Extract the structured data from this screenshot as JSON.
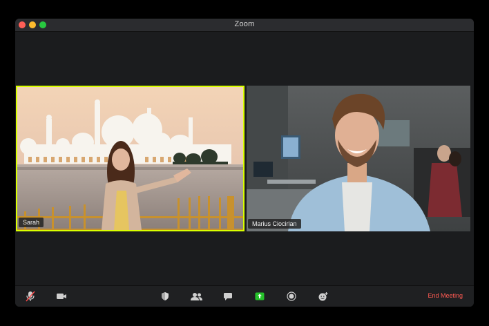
{
  "window": {
    "title": "Zoom"
  },
  "participants": [
    {
      "name": "Sarah"
    },
    {
      "name": "Marius Ciocirlan"
    }
  ],
  "toolbar": {
    "end_meeting_label": "End Meeting",
    "icons": {
      "mic": "microphone-muted-icon",
      "video": "video-camera-icon",
      "security": "shield-icon",
      "participants": "participants-icon",
      "chat": "chat-icon",
      "share": "share-screen-icon",
      "record": "record-icon",
      "reactions": "reactions-icon"
    },
    "share_color": "#25c12a",
    "end_meeting_color": "#ff5a52"
  }
}
